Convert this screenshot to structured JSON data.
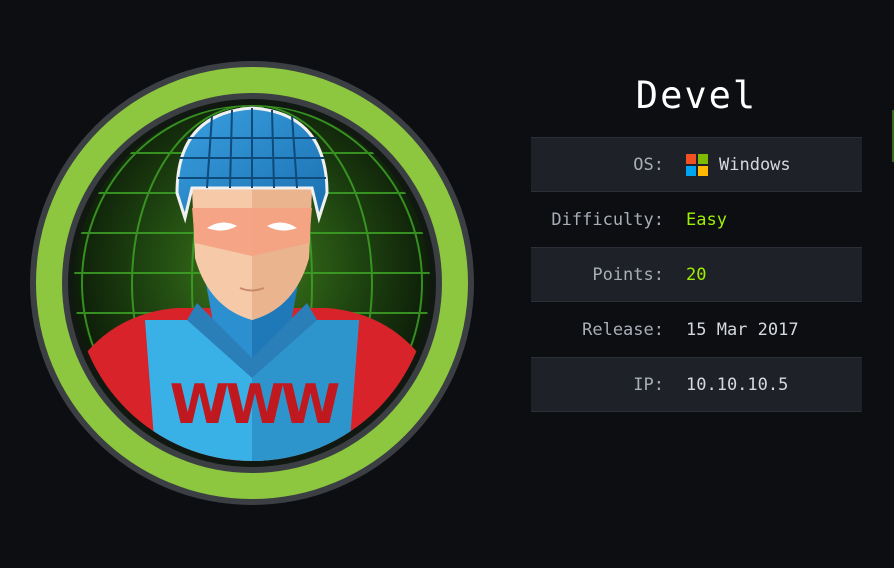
{
  "machine": {
    "name": "Devel"
  },
  "info": {
    "os": {
      "label": "OS:",
      "value": "Windows",
      "icon": "windows-logo-icon"
    },
    "difficulty": {
      "label": "Difficulty:",
      "value": "Easy"
    },
    "points": {
      "label": "Points:",
      "value": "20"
    },
    "release": {
      "label": "Release:",
      "value": "15 Mar 2017"
    },
    "ip": {
      "label": "IP:",
      "value": "10.10.10.5"
    }
  },
  "avatar": {
    "badge_text": "WWW",
    "ring_color": "#8dc63f",
    "icon": "avatar-www-man"
  },
  "colors": {
    "background": "#0c0e12",
    "accent_green": "#9fef00",
    "row_shade": "#1e2228"
  }
}
